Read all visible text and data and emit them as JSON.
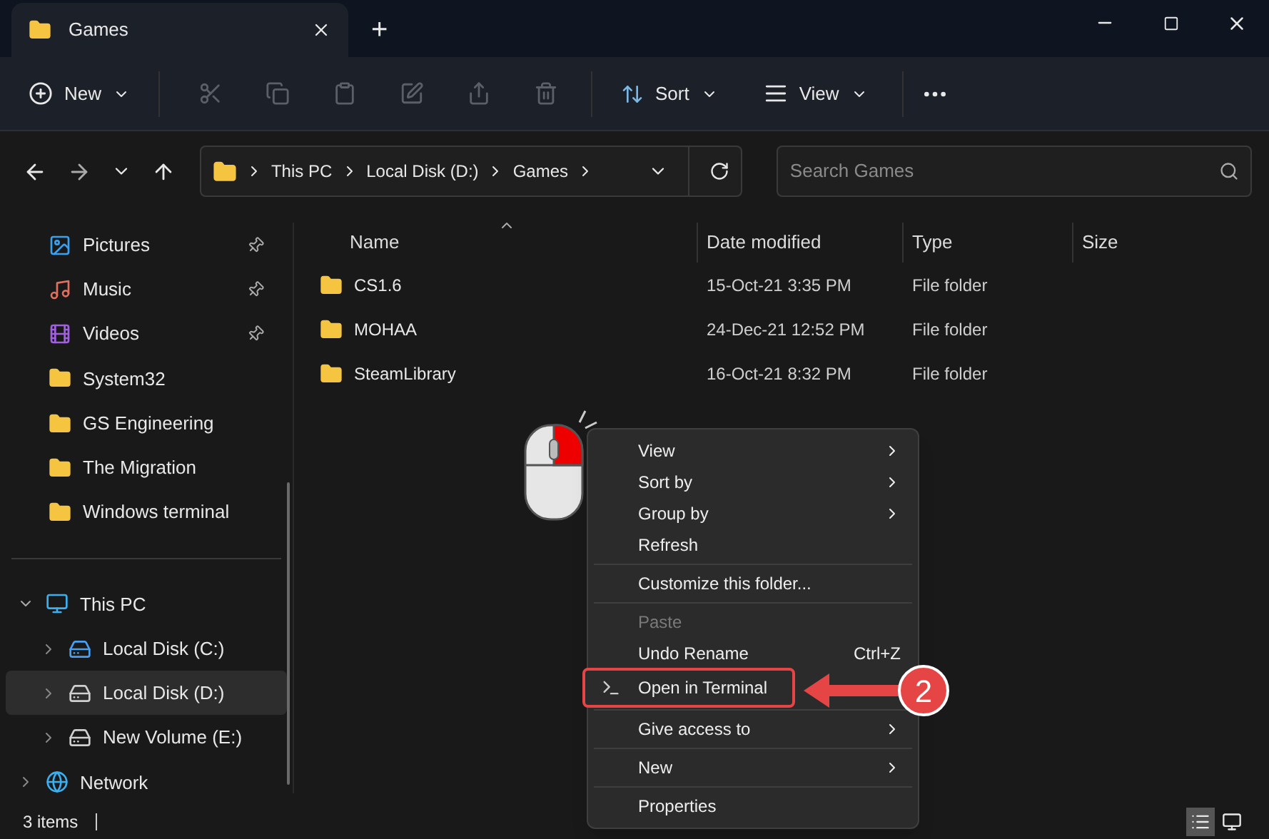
{
  "window": {
    "tab_title": "Games",
    "new_tab": "+"
  },
  "toolbar": {
    "new_label": "New",
    "icon_buttons": [
      {
        "disabled": true
      },
      {
        "disabled": true
      },
      {
        "disabled": true
      },
      {
        "disabled": true
      },
      {
        "disabled": true
      },
      {
        "disabled": true
      }
    ],
    "sort_label": "Sort",
    "view_label": "View"
  },
  "address": {
    "crumbs": [
      "This PC",
      "Local Disk (D:)",
      "Games"
    ],
    "search_placeholder": "Search Games"
  },
  "sidebar": {
    "items": [
      {
        "label": "Pictures",
        "kind": "pictures",
        "pinned": true
      },
      {
        "label": "Music",
        "kind": "music",
        "pinned": true
      },
      {
        "label": "Videos",
        "kind": "videos",
        "pinned": true
      },
      {
        "label": "System32",
        "kind": "folder",
        "pinned": false
      },
      {
        "label": "GS Engineering",
        "kind": "folder",
        "pinned": false
      },
      {
        "label": "The Migration",
        "kind": "folder",
        "pinned": false
      },
      {
        "label": "Windows terminal",
        "kind": "folder",
        "pinned": false
      }
    ],
    "tree": [
      {
        "label": "This PC",
        "kind": "pc",
        "expanded": true,
        "selected": false,
        "children": [
          {
            "label": "Local Disk (C:)",
            "kind": "system-drive",
            "expanded": false,
            "selected": false
          },
          {
            "label": "Local Disk (D:)",
            "kind": "drive",
            "expanded": false,
            "selected": true
          },
          {
            "label": "New Volume (E:)",
            "kind": "drive",
            "expanded": false,
            "selected": false
          }
        ]
      },
      {
        "label": "Network",
        "kind": "network",
        "expanded": false,
        "selected": false
      }
    ]
  },
  "table": {
    "columns": [
      "Name",
      "Date modified",
      "Type",
      "Size"
    ],
    "rows": [
      {
        "name": "CS1.6",
        "date": "15-Oct-21 3:35 PM",
        "type": "File folder"
      },
      {
        "name": "MOHAA",
        "date": "24-Dec-21 12:52 PM",
        "type": "File folder"
      },
      {
        "name": "SteamLibrary",
        "date": "16-Oct-21 8:32 PM",
        "type": "File folder"
      }
    ]
  },
  "context_menu": [
    {
      "kind": "item",
      "label": "View",
      "submenu": true,
      "disabled": false,
      "highlighted": false
    },
    {
      "kind": "item",
      "label": "Sort by",
      "submenu": true,
      "disabled": false,
      "highlighted": false
    },
    {
      "kind": "item",
      "label": "Group by",
      "submenu": true,
      "disabled": false,
      "highlighted": false
    },
    {
      "kind": "item",
      "label": "Refresh",
      "submenu": false,
      "disabled": false,
      "highlighted": false
    },
    {
      "kind": "separator"
    },
    {
      "kind": "item",
      "label": "Customize this folder...",
      "submenu": false,
      "disabled": false,
      "highlighted": false
    },
    {
      "kind": "separator"
    },
    {
      "kind": "item",
      "label": "Paste",
      "submenu": false,
      "disabled": true,
      "highlighted": false
    },
    {
      "kind": "item",
      "label": "Undo Rename",
      "shortcut": "Ctrl+Z",
      "submenu": false,
      "disabled": false,
      "highlighted": false
    },
    {
      "kind": "item",
      "label": "Open in Terminal",
      "submenu": false,
      "disabled": false,
      "highlighted": true,
      "terminal_icon": true
    },
    {
      "kind": "separator"
    },
    {
      "kind": "item",
      "label": "Give access to",
      "submenu": true,
      "disabled": false,
      "highlighted": false
    },
    {
      "kind": "separator"
    },
    {
      "kind": "item",
      "label": "New",
      "submenu": true,
      "disabled": false,
      "highlighted": false
    },
    {
      "kind": "separator"
    },
    {
      "kind": "item",
      "label": "Properties",
      "submenu": false,
      "disabled": false,
      "highlighted": false
    }
  ],
  "callout": {
    "number": "2"
  },
  "status_bar": {
    "count": "3 items",
    "view_buttons": [
      {
        "selected": true
      },
      {
        "selected": false
      }
    ]
  }
}
